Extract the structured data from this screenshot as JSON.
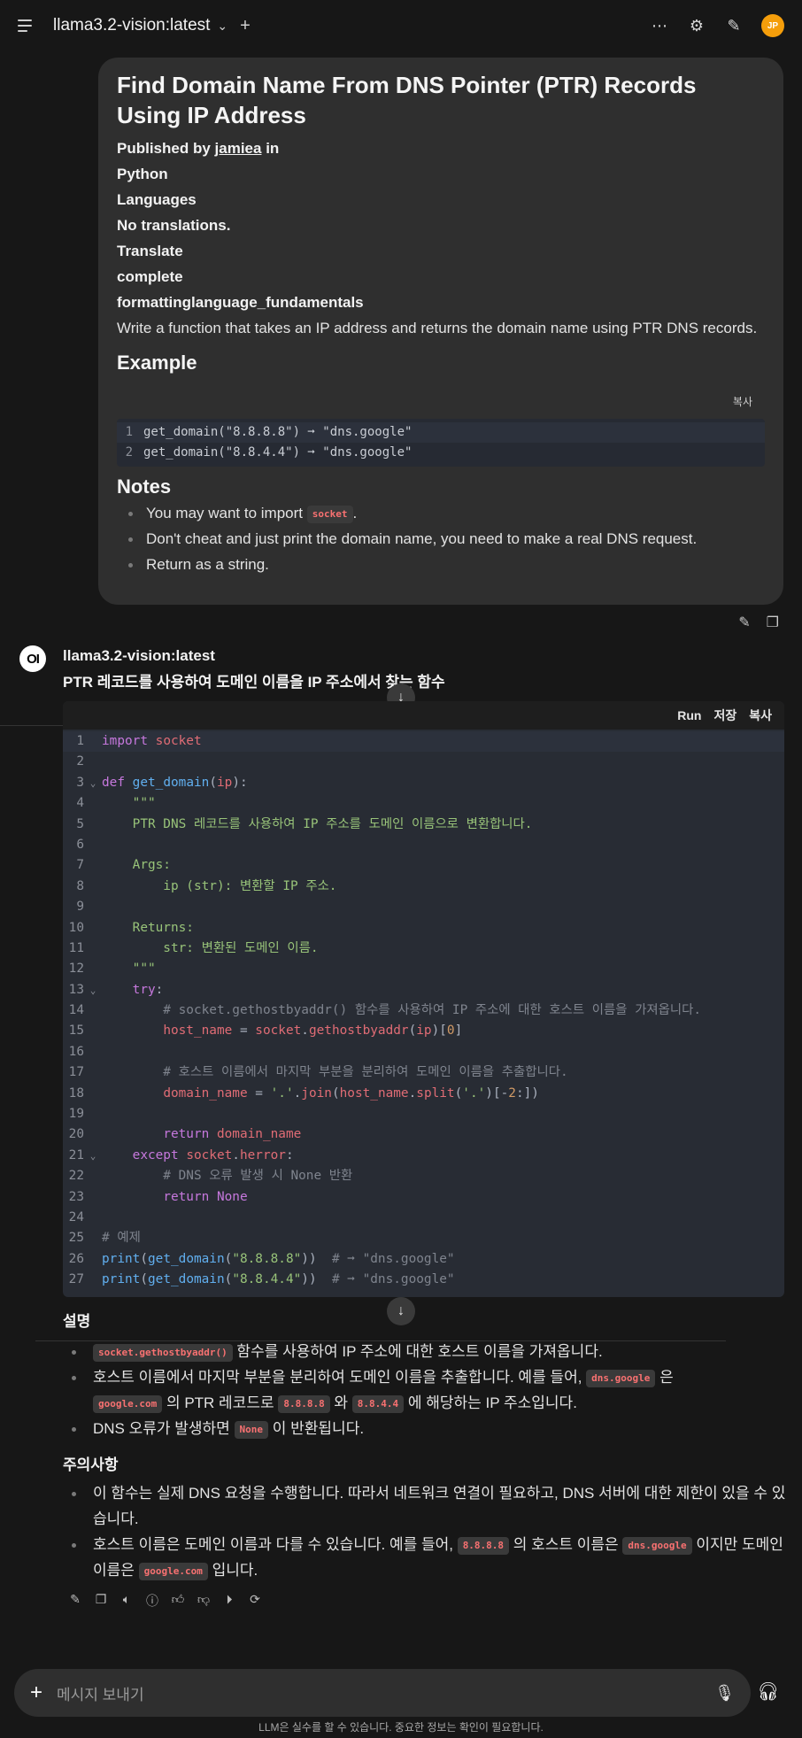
{
  "header": {
    "model": "llama3.2-vision:latest",
    "chevron": "⌄",
    "new_chat": "+",
    "more": "⋯",
    "controls": "⚙",
    "edit": "✎",
    "avatar": "JP"
  },
  "user_message": {
    "title": "Find Domain Name From DNS Pointer (PTR) Records Using IP Address",
    "published_prefix": "Published by ",
    "author": "jamiea",
    "published_suffix": " in",
    "lines": [
      "Python",
      "Languages",
      "No translations.",
      "Translate",
      "complete",
      "formattinglanguage_fundamentals"
    ],
    "description": "Write a function that takes an IP address and returns the domain name using PTR DNS records.",
    "example_heading": "Example",
    "copy_label": "복사",
    "example_code": [
      {
        "n": "1",
        "code": "get_domain(\"8.8.8.8\") ➞ \"dns.google\""
      },
      {
        "n": "2",
        "code": "get_domain(\"8.8.4.4\") ➞ \"dns.google\""
      }
    ],
    "notes_heading": "Notes",
    "notes": {
      "n1_pre": "You may want to import ",
      "n1_chip": "socket",
      "n1_post": ".",
      "n2": "Don't cheat and just print the domain name, you need to make a real DNS request.",
      "n3": "Return as a string."
    }
  },
  "assistant": {
    "logo": "OI",
    "name": "llama3.2-vision:latest",
    "heading": "PTR 레코드를 사용하여 도메인 이름을 IP 주소에서 찾는 함수",
    "code_actions": {
      "run": "Run",
      "save": "저장",
      "copy": "복사"
    },
    "code_lines": [
      {
        "n": "1",
        "fold": "",
        "tokens": [
          {
            "c": "kw",
            "t": "import"
          },
          {
            "c": "pl",
            "t": " "
          },
          {
            "c": "vr",
            "t": "socket"
          }
        ]
      },
      {
        "n": "2",
        "fold": "",
        "tokens": []
      },
      {
        "n": "3",
        "fold": "⌄",
        "tokens": [
          {
            "c": "kw",
            "t": "def"
          },
          {
            "c": "pl",
            "t": " "
          },
          {
            "c": "fn",
            "t": "get_domain"
          },
          {
            "c": "pl",
            "t": "("
          },
          {
            "c": "vr",
            "t": "ip"
          },
          {
            "c": "pl",
            "t": "):"
          }
        ]
      },
      {
        "n": "4",
        "fold": "",
        "tokens": [
          {
            "c": "st",
            "t": "    \"\"\""
          }
        ]
      },
      {
        "n": "5",
        "fold": "",
        "tokens": [
          {
            "c": "st",
            "t": "    PTR DNS 레코드를 사용하여 IP 주소를 도메인 이름으로 변환합니다."
          }
        ]
      },
      {
        "n": "6",
        "fold": "",
        "tokens": []
      },
      {
        "n": "7",
        "fold": "",
        "tokens": [
          {
            "c": "st",
            "t": "    Args:"
          }
        ]
      },
      {
        "n": "8",
        "fold": "",
        "tokens": [
          {
            "c": "st",
            "t": "        ip (str): 변환할 IP 주소."
          }
        ]
      },
      {
        "n": "9",
        "fold": "",
        "tokens": []
      },
      {
        "n": "10",
        "fold": "",
        "tokens": [
          {
            "c": "st",
            "t": "    Returns:"
          }
        ]
      },
      {
        "n": "11",
        "fold": "",
        "tokens": [
          {
            "c": "st",
            "t": "        str: 변환된 도메인 이름."
          }
        ]
      },
      {
        "n": "12",
        "fold": "",
        "tokens": [
          {
            "c": "st",
            "t": "    \"\"\""
          }
        ]
      },
      {
        "n": "13",
        "fold": "⌄",
        "tokens": [
          {
            "c": "pl",
            "t": "    "
          },
          {
            "c": "kw",
            "t": "try"
          },
          {
            "c": "pl",
            "t": ":"
          }
        ]
      },
      {
        "n": "14",
        "fold": "",
        "tokens": [
          {
            "c": "cm",
            "t": "        # socket.gethostbyaddr() 함수를 사용하여 IP 주소에 대한 호스트 이름을 가져옵니다."
          }
        ]
      },
      {
        "n": "15",
        "fold": "",
        "tokens": [
          {
            "c": "pl",
            "t": "        "
          },
          {
            "c": "vr",
            "t": "host_name"
          },
          {
            "c": "pl",
            "t": " = "
          },
          {
            "c": "vr",
            "t": "socket"
          },
          {
            "c": "pl",
            "t": "."
          },
          {
            "c": "vr",
            "t": "gethostbyaddr"
          },
          {
            "c": "pl",
            "t": "("
          },
          {
            "c": "vr",
            "t": "ip"
          },
          {
            "c": "pl",
            "t": ")["
          },
          {
            "c": "nm",
            "t": "0"
          },
          {
            "c": "pl",
            "t": "]"
          }
        ]
      },
      {
        "n": "16",
        "fold": "",
        "tokens": []
      },
      {
        "n": "17",
        "fold": "",
        "tokens": [
          {
            "c": "cm",
            "t": "        # 호스트 이름에서 마지막 부분을 분리하여 도메인 이름을 추출합니다."
          }
        ]
      },
      {
        "n": "18",
        "fold": "",
        "tokens": [
          {
            "c": "pl",
            "t": "        "
          },
          {
            "c": "vr",
            "t": "domain_name"
          },
          {
            "c": "pl",
            "t": " = "
          },
          {
            "c": "st",
            "t": "'.'"
          },
          {
            "c": "pl",
            "t": "."
          },
          {
            "c": "vr",
            "t": "join"
          },
          {
            "c": "pl",
            "t": "("
          },
          {
            "c": "vr",
            "t": "host_name"
          },
          {
            "c": "pl",
            "t": "."
          },
          {
            "c": "vr",
            "t": "split"
          },
          {
            "c": "pl",
            "t": "("
          },
          {
            "c": "st",
            "t": "'.'"
          },
          {
            "c": "pl",
            "t": ")["
          },
          {
            "c": "pl",
            "t": "-"
          },
          {
            "c": "nm",
            "t": "2"
          },
          {
            "c": "pl",
            "t": ":])"
          }
        ]
      },
      {
        "n": "19",
        "fold": "",
        "tokens": []
      },
      {
        "n": "20",
        "fold": "",
        "tokens": [
          {
            "c": "pl",
            "t": "        "
          },
          {
            "c": "kw",
            "t": "return"
          },
          {
            "c": "pl",
            "t": " "
          },
          {
            "c": "vr",
            "t": "domain_name"
          }
        ]
      },
      {
        "n": "21",
        "fold": "⌄",
        "tokens": [
          {
            "c": "pl",
            "t": "    "
          },
          {
            "c": "kw",
            "t": "except"
          },
          {
            "c": "pl",
            "t": " "
          },
          {
            "c": "vr",
            "t": "socket"
          },
          {
            "c": "pl",
            "t": "."
          },
          {
            "c": "vr",
            "t": "herror"
          },
          {
            "c": "pl",
            "t": ":"
          }
        ]
      },
      {
        "n": "22",
        "fold": "",
        "tokens": [
          {
            "c": "cm",
            "t": "        # DNS 오류 발생 시 None 반환"
          }
        ]
      },
      {
        "n": "23",
        "fold": "",
        "tokens": [
          {
            "c": "pl",
            "t": "        "
          },
          {
            "c": "kw",
            "t": "return"
          },
          {
            "c": "pl",
            "t": " "
          },
          {
            "c": "kw",
            "t": "None"
          }
        ]
      },
      {
        "n": "24",
        "fold": "",
        "tokens": []
      },
      {
        "n": "25",
        "fold": "",
        "tokens": [
          {
            "c": "cm",
            "t": "# 예제"
          }
        ]
      },
      {
        "n": "26",
        "fold": "",
        "tokens": [
          {
            "c": "fn",
            "t": "print"
          },
          {
            "c": "pl",
            "t": "("
          },
          {
            "c": "fn",
            "t": "get_domain"
          },
          {
            "c": "pl",
            "t": "("
          },
          {
            "c": "st",
            "t": "\"8.8.8.8\""
          },
          {
            "c": "pl",
            "t": "))  "
          },
          {
            "c": "cm",
            "t": "# ➞ \"dns.google\""
          }
        ]
      },
      {
        "n": "27",
        "fold": "",
        "tokens": [
          {
            "c": "fn",
            "t": "print"
          },
          {
            "c": "pl",
            "t": "("
          },
          {
            "c": "fn",
            "t": "get_domain"
          },
          {
            "c": "pl",
            "t": "("
          },
          {
            "c": "st",
            "t": "\"8.8.4.4\""
          },
          {
            "c": "pl",
            "t": "))  "
          },
          {
            "c": "cm",
            "t": "# ➞ \"dns.google\""
          }
        ]
      }
    ],
    "explain_heading": "설명",
    "explain": {
      "e1_chip": "socket.gethostbyaddr()",
      "e1_text": " 함수를 사용하여 IP 주소에 대한 호스트 이름을 가져옵니다.",
      "e2_a": "호스트 이름에서 마지막 부분을 분리하여 도메인 이름을 추출합니다. 예를 들어, ",
      "e2_chip1": "dns.google",
      "e2_b": " 은",
      "e2_chip2": "google.com",
      "e2_c": " 의 PTR 레코드로 ",
      "e2_chip3": "8.8.8.8",
      "e2_d": " 와 ",
      "e2_chip4": "8.8.4.4",
      "e2_e": " 에 해당하는 IP 주소입니다.",
      "e3_a": "DNS 오류가 발생하면 ",
      "e3_chip": "None",
      "e3_b": " 이 반환됩니다."
    },
    "caution_heading": "주의사항",
    "caution": {
      "c1": "이 함수는 실제 DNS 요청을 수행합니다. 따라서 네트워크 연결이 필요하고, DNS 서버에 대한 제한이 있을 수 있습니다.",
      "c2_a": "호스트 이름은 도메인 이름과 다를 수 있습니다. 예를 들어, ",
      "c2_chip1": "8.8.8.8",
      "c2_b": " 의 호스트 이름은 ",
      "c2_chip2": "dns.google",
      "c2_c": " 이지만 도메인 이름은 ",
      "c2_chip3": "google.com",
      "c2_d": " 입니다."
    }
  },
  "composer": {
    "placeholder": "메시지 보내기",
    "disclaimer": "LLM은 실수를 할 수 있습니다. 중요한 정보는 확인이 필요합니다."
  }
}
